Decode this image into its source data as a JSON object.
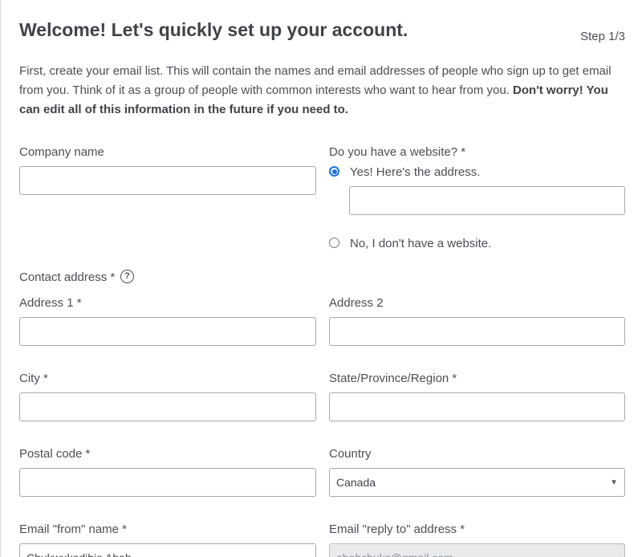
{
  "header": {
    "title": "Welcome! Let's quickly set up your account.",
    "step": "Step 1/3"
  },
  "intro": {
    "text": "First, create your email list. This will contain the names and email addresses of people who sign up to get email from you. Think of it as a group of people with common interests who want to hear from you. ",
    "bold": "Don't worry! You can edit all of this information in the future if you need to."
  },
  "company": {
    "label": "Company name",
    "value": ""
  },
  "website": {
    "question": "Do you have a website? *",
    "yes_label": "Yes! Here's the address.",
    "yes_selected": true,
    "url_value": "",
    "no_label": "No, I don't have a website."
  },
  "contact": {
    "label": "Contact address *",
    "help_glyph": "?",
    "address1_label": "Address 1 *",
    "address1_value": "",
    "address2_label": "Address 2",
    "address2_value": "",
    "city_label": "City *",
    "city_value": "",
    "state_label": "State/Province/Region *",
    "state_value": "",
    "postal_label": "Postal code *",
    "postal_value": "",
    "country_label": "Country",
    "country_value": "Canada",
    "caret": "▼"
  },
  "email": {
    "from_label": "Email \"from\" name *",
    "from_value": "Chukwukadibia Abah",
    "reply_label": "Email \"reply to\" address *",
    "reply_value": "abahchuks@gmail.com"
  },
  "colors": {
    "accent": "#1a73e8",
    "text": "#41454d",
    "border": "#a5a9ae",
    "disabled_bg": "#e8eaec"
  }
}
